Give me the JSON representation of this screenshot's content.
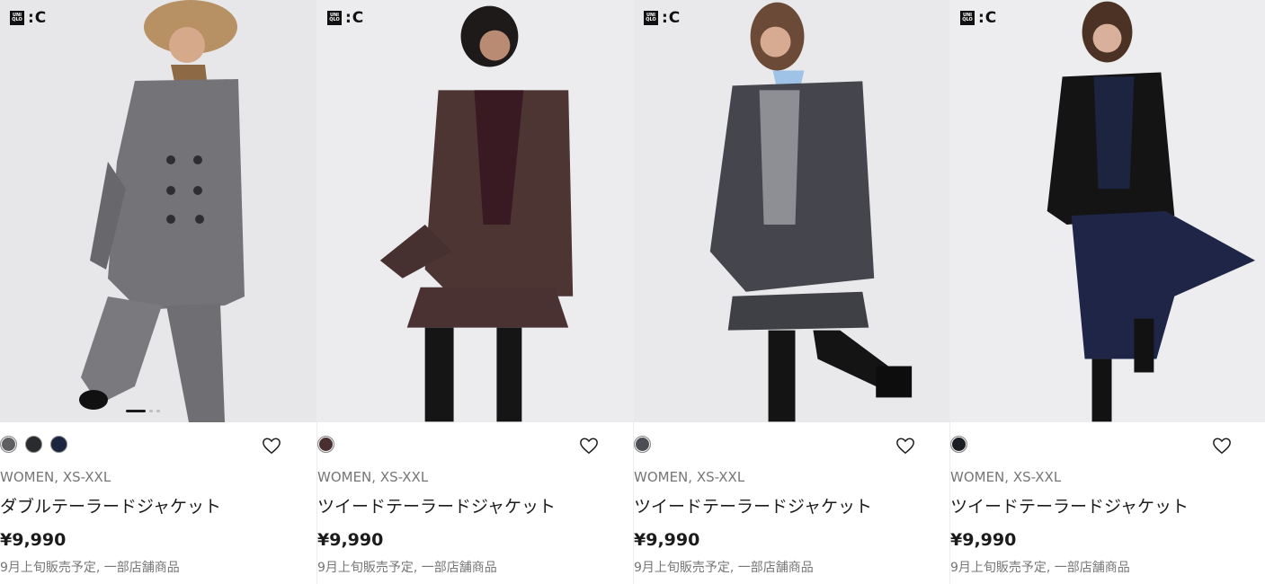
{
  "brand": {
    "box_text": "UNI QLO",
    "label": ":C"
  },
  "products": [
    {
      "swatches": [
        "#5f5f61",
        "#2a2b2e",
        "#1d2440"
      ],
      "meta": "WOMEN, XS-XXL",
      "name": "ダブルテーラードジャケット",
      "price": "¥9,990",
      "note": "9月上旬販売予定, 一部店舗商品",
      "photo_bg": "#e7e7e9",
      "jacket_color": "#707074"
    },
    {
      "swatches": [
        "#4a2f30"
      ],
      "meta": "WOMEN, XS-XXL",
      "name": "ツイードテーラードジャケット",
      "price": "¥9,990",
      "note": "9月上旬販売予定, 一部店舗商品",
      "photo_bg": "#ececee",
      "jacket_color": "#4d3533"
    },
    {
      "swatches": [
        "#4c4d55"
      ],
      "meta": "WOMEN, XS-XXL",
      "name": "ツイードテーラードジャケット",
      "price": "¥9,990",
      "note": "9月上旬販売予定, 一部店舗商品",
      "photo_bg": "#e9e9eb",
      "jacket_color": "#45464d"
    },
    {
      "swatches": [
        "#1b1d24"
      ],
      "meta": "WOMEN, XS-XXL",
      "name": "ツイードテーラードジャケット",
      "price": "¥9,990",
      "note": "9月上旬販売予定, 一部店舗商品",
      "photo_bg": "#ededef",
      "jacket_color": "#141414"
    }
  ],
  "icons": {
    "favorite": "heart-outline-icon",
    "brand": "uniqlo-c-logo"
  }
}
